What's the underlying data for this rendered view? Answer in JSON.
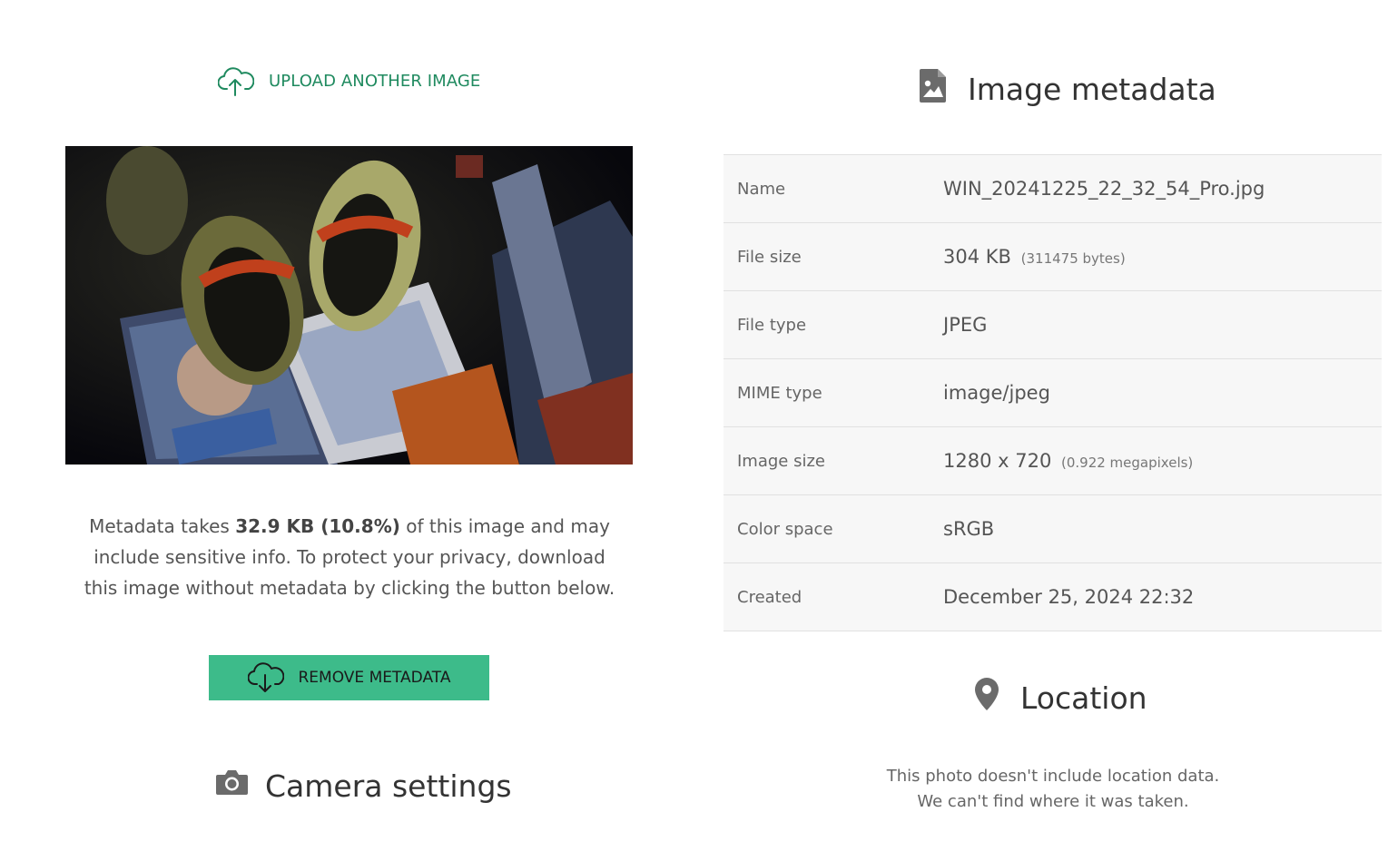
{
  "upload": {
    "label": "UPLOAD ANOTHER IMAGE",
    "icon": "cloud-upload-icon"
  },
  "note": {
    "prefix": "Metadata takes ",
    "size_bold": "32.9 KB (10.8%)",
    "suffix": " of this image and may include sensitive info. To protect your privacy, download this image without metadata by clicking the button below."
  },
  "remove_button": {
    "label": "REMOVE METADATA",
    "icon": "cloud-download-icon"
  },
  "camera": {
    "heading": "Camera settings",
    "icon": "camera-icon"
  },
  "metadata": {
    "heading": "Image metadata",
    "icon": "file-image-icon",
    "rows": [
      {
        "key": "Name",
        "value": "WIN_20241225_22_32_54_Pro.jpg",
        "extra": ""
      },
      {
        "key": "File size",
        "value": "304 KB",
        "extra": "(311475 bytes)"
      },
      {
        "key": "File type",
        "value": "JPEG",
        "extra": ""
      },
      {
        "key": "MIME type",
        "value": "image/jpeg",
        "extra": ""
      },
      {
        "key": "Image size",
        "value": "1280 x 720",
        "extra": "(0.922 megapixels)"
      },
      {
        "key": "Color space",
        "value": "sRGB",
        "extra": ""
      },
      {
        "key": "Created",
        "value": "December 25, 2024 22:32",
        "extra": ""
      }
    ]
  },
  "location": {
    "heading": "Location",
    "icon": "map-pin-icon",
    "line1": "This photo doesn't include location data.",
    "line2": "We can't find where it was taken."
  },
  "colors": {
    "accent_link": "#1f8a5f",
    "button_bg": "#3dbb8a",
    "row_shade": "#f7f7f7"
  }
}
